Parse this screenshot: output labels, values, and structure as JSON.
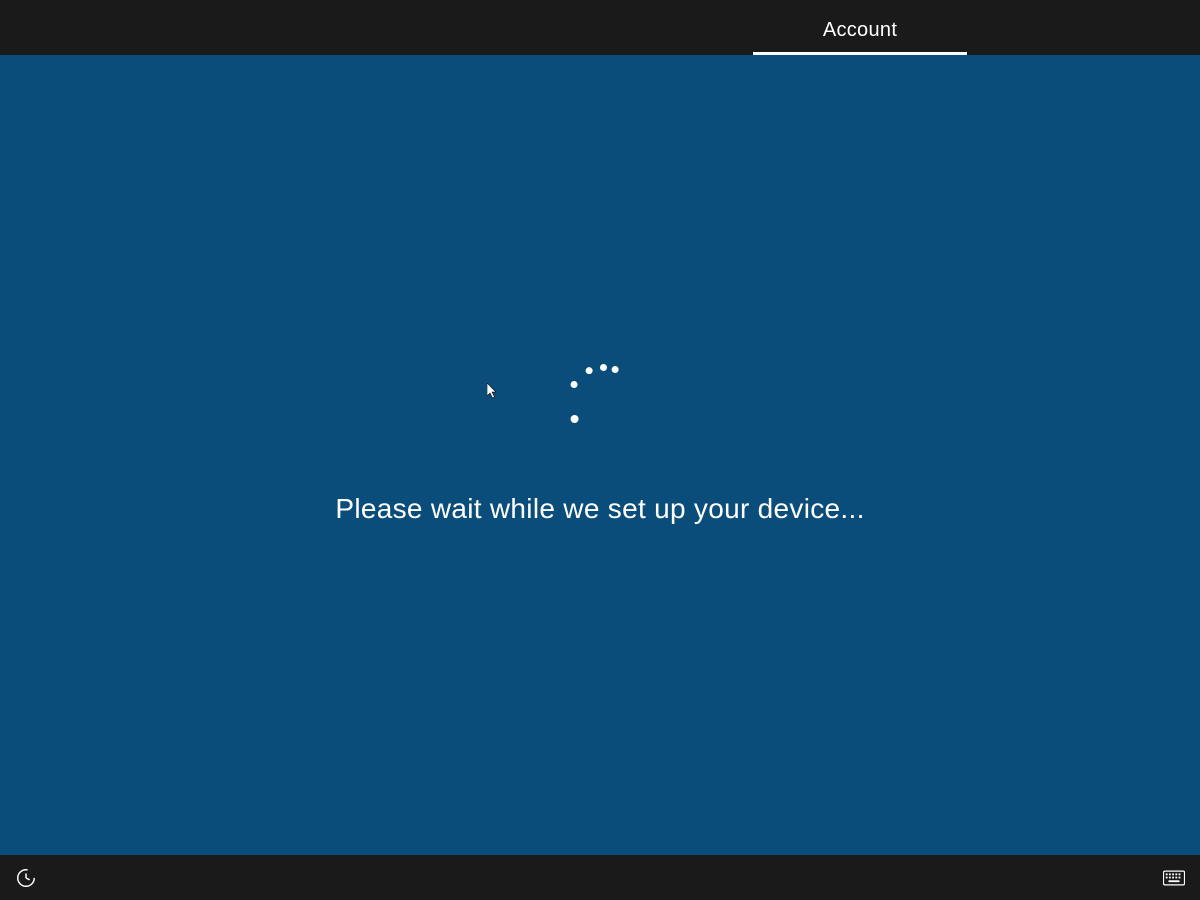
{
  "header": {
    "active_phase_label": "Account"
  },
  "main": {
    "spinner_icon": "loading-spinner-icon",
    "status_message": "Please wait while we set up your device..."
  },
  "footer": {
    "left_icon": "ease-of-access-icon",
    "right_icon": "on-screen-keyboard-icon"
  },
  "colors": {
    "background": "#0b4d7a",
    "bar": "#1a1a1a",
    "text": "#ffffff"
  }
}
